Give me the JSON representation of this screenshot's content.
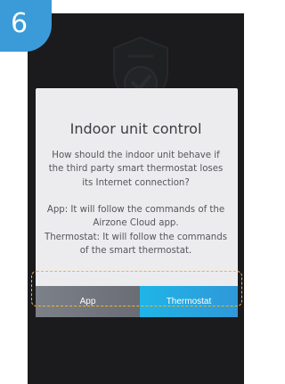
{
  "step": {
    "number": "6",
    "color": "#3b9bd8"
  },
  "background": {
    "icon": "shield-check-icon"
  },
  "dialog": {
    "title": "Indoor unit control",
    "body": "How should the indoor unit behave if the third party smart thermostat loses its Internet connection?\n\nApp: It will follow the commands of the Airzone Cloud app.\nThermostat: It will follow the commands of the smart thermostat.",
    "buttons": {
      "app_label": "App",
      "thermostat_label": "Thermostat"
    }
  },
  "colors": {
    "highlight": "#f4b334",
    "app_button": "#747780",
    "thermostat_button": "#27a7e0",
    "dialog_background": "#ececee",
    "screen_background": "#1b1b1d"
  }
}
